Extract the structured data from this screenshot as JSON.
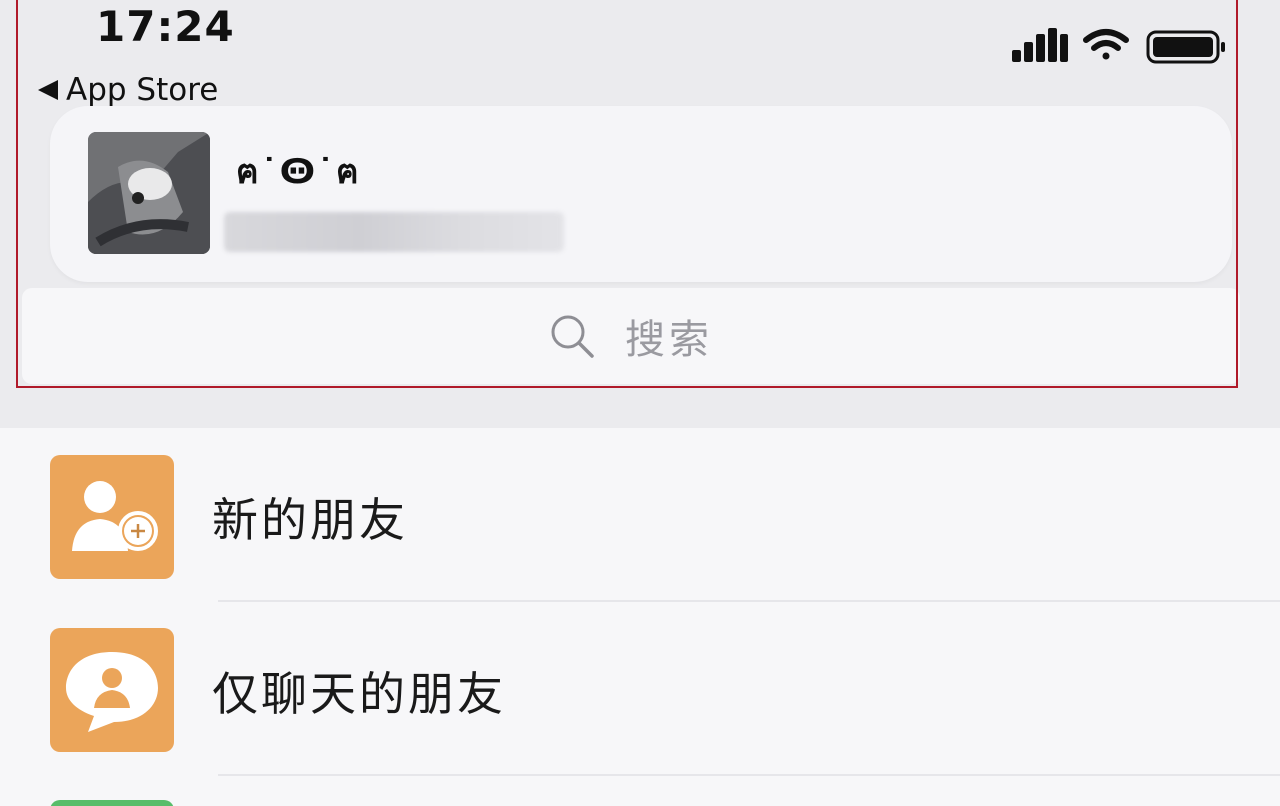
{
  "status_bar": {
    "time": "17:24",
    "signal_icon": "cellular-signal-icon",
    "wifi_icon": "wifi-icon",
    "battery_icon": "battery-icon"
  },
  "nav": {
    "back_label": "App Store",
    "back_icon": "back-triangle-icon"
  },
  "profile": {
    "name": "ฅ˙Ꙫ˙ฅ",
    "subtitle_blurred": true
  },
  "search": {
    "placeholder": "搜索",
    "icon": "search-icon"
  },
  "contacts": {
    "items": [
      {
        "label": "新的朋友",
        "icon": "add-friend-icon",
        "color": "#eba55a"
      },
      {
        "label": "仅聊天的朋友",
        "icon": "chat-only-friend-icon",
        "color": "#eba55a"
      }
    ],
    "partial_next_icon_color": "#58bd6a"
  },
  "colors": {
    "highlight_border": "#b01a2a",
    "background": "#ebebee"
  }
}
